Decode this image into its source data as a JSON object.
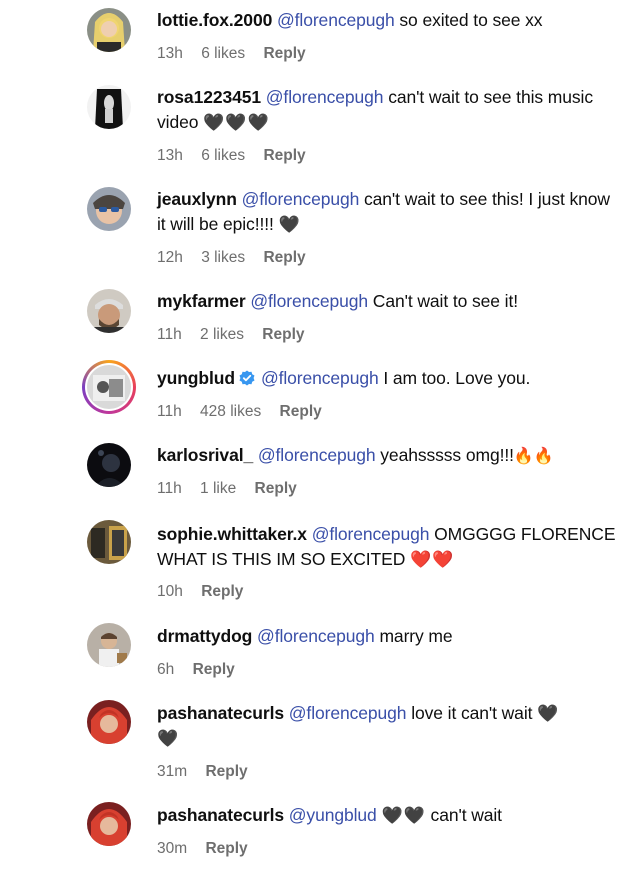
{
  "comments": [
    {
      "user": "lottie.fox.2000",
      "mention": "@florencepugh",
      "text": "so exited to see xx",
      "extra": "",
      "time": "13h",
      "likes": "6 likes",
      "reply": "Reply"
    },
    {
      "user": "rosa1223451",
      "mention": "@florencepugh",
      "text": "can't wait to see this music video",
      "extra": "🖤🖤🖤",
      "time": "13h",
      "likes": "6 likes",
      "reply": "Reply"
    },
    {
      "user": "jeauxlynn",
      "mention": "@florencepugh",
      "text": "can't wait to see this! I just know it will be epic!!!!",
      "extra": "🖤",
      "time": "12h",
      "likes": "3 likes",
      "reply": "Reply"
    },
    {
      "user": "mykfarmer",
      "mention": "@florencepugh",
      "text": "Can't wait to see it!",
      "extra": "",
      "time": "11h",
      "likes": "2 likes",
      "reply": "Reply"
    },
    {
      "user": "yungblud",
      "mention": "@florencepugh",
      "text": "I am too. Love you.",
      "extra": "",
      "time": "11h",
      "likes": "428 likes",
      "reply": "Reply"
    },
    {
      "user": "karlosrival_",
      "mention": "@florencepugh",
      "text": "yeahsssss omg!!!",
      "extra": "🔥🔥",
      "time": "11h",
      "likes": "1 like",
      "reply": "Reply"
    },
    {
      "user": "sophie.whittaker.x",
      "mention": "@florencepugh",
      "text": "OMGGGG FLORENCE WHAT IS THIS IM SO EXCITED",
      "extra": "❤️❤️",
      "time": "10h",
      "likes": "",
      "reply": "Reply"
    },
    {
      "user": "drmattydog",
      "mention": "@florencepugh",
      "text": "marry me",
      "extra": "",
      "time": "6h",
      "likes": "",
      "reply": "Reply"
    },
    {
      "user": "pashanatecurls",
      "mention": "@florencepugh",
      "text": "love it can't wait",
      "extra": "🖤 🖤",
      "time": "31m",
      "likes": "",
      "reply": "Reply"
    },
    {
      "user": "pashanatecurls",
      "mention": "@yungblud",
      "text": "can't wait",
      "extra": "🖤🖤",
      "time": "30m",
      "likes": "",
      "reply": "Reply"
    }
  ],
  "icons": {
    "verified": "verified-badge-icon",
    "heart_black": "black-heart-emoji",
    "heart_red": "red-heart-emoji",
    "fire": "fire-emoji"
  },
  "colors": {
    "mention": "#3a4fa8",
    "meta": "#6e6e6e",
    "verified": "#3897f0"
  }
}
